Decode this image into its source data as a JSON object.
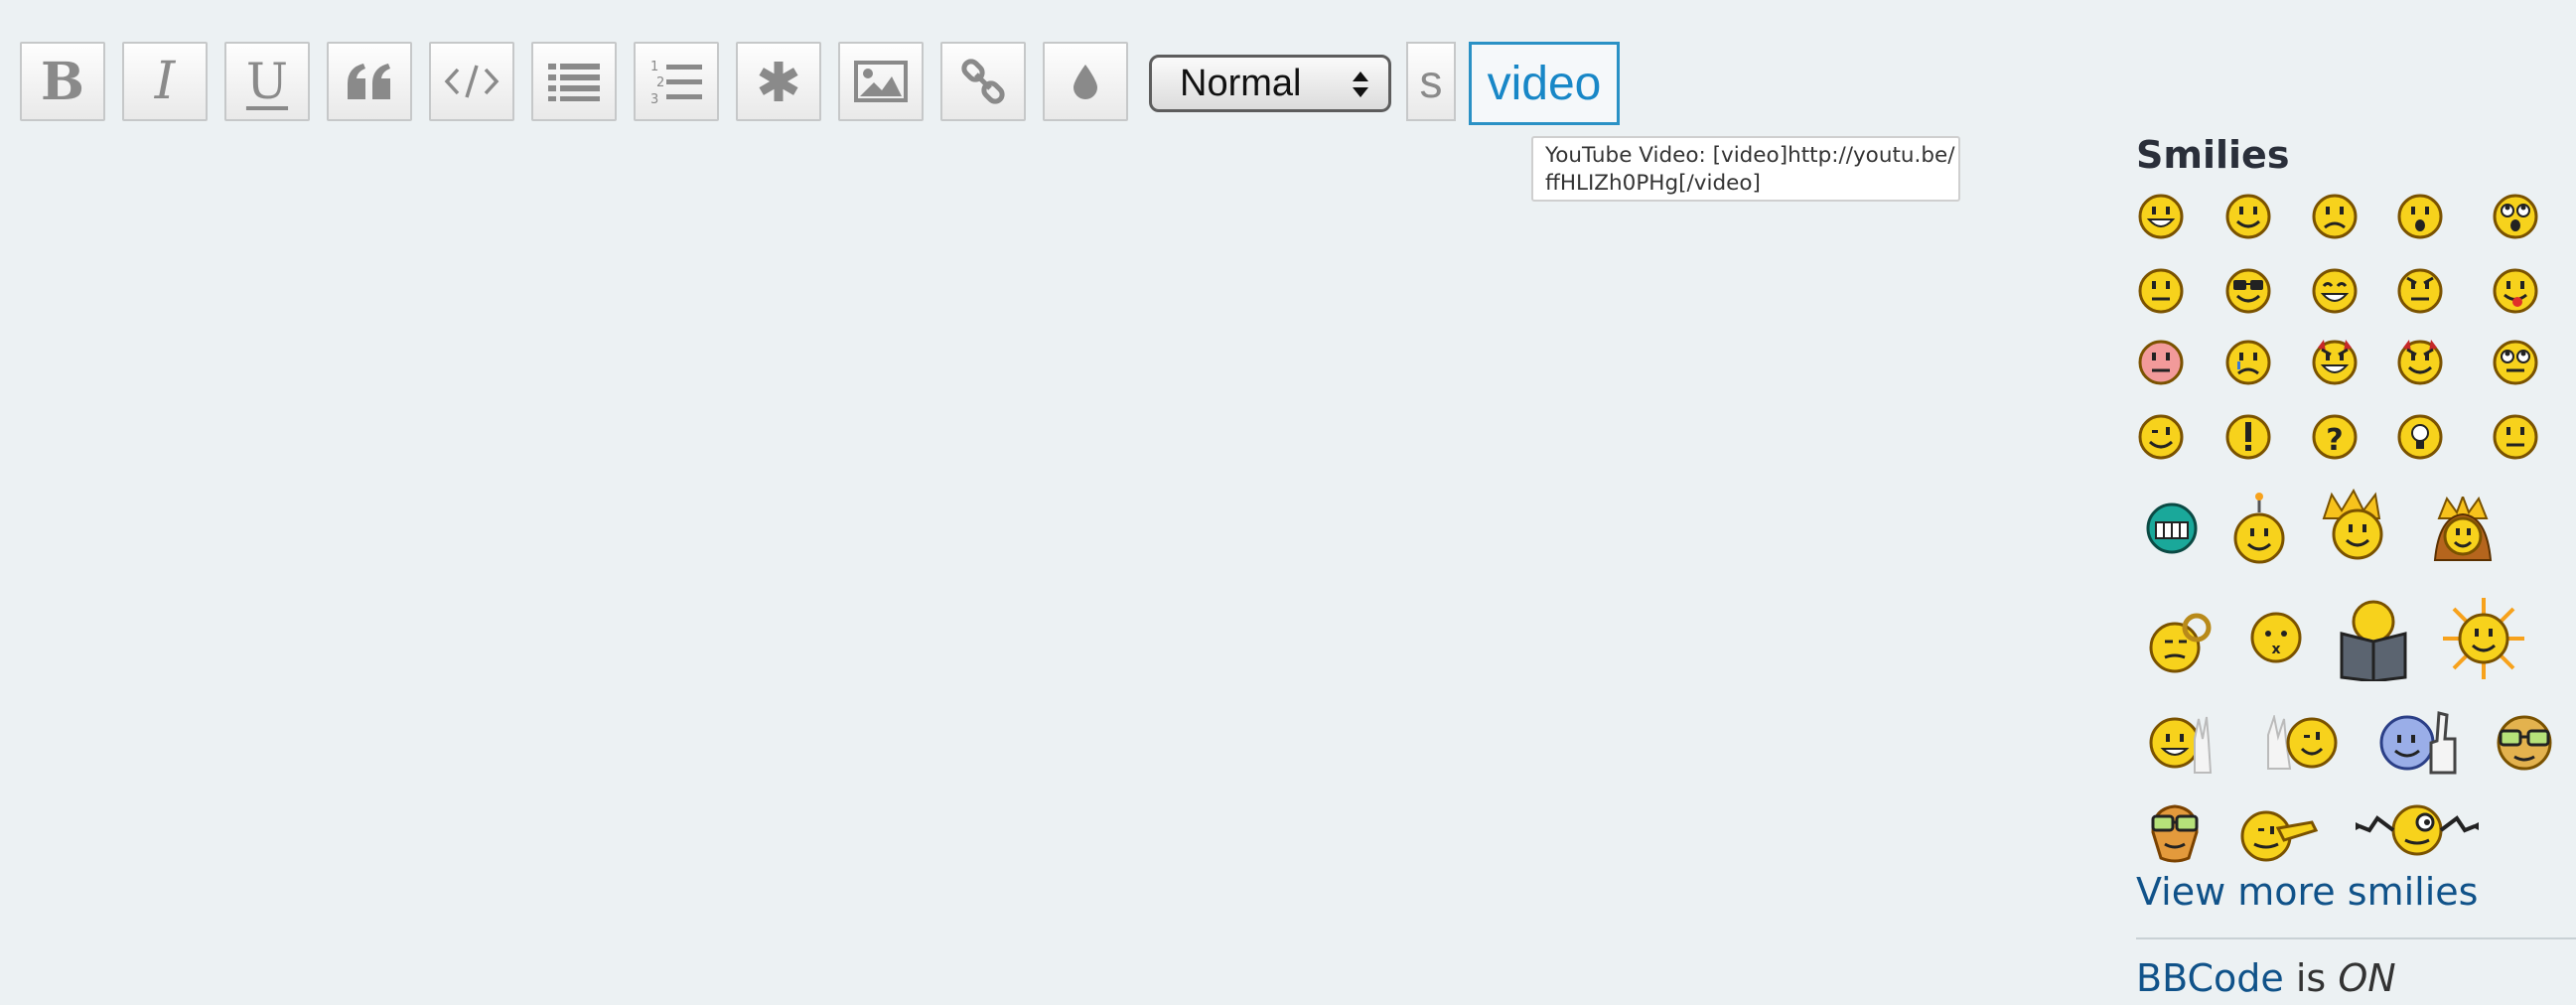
{
  "toolbar": {
    "bold_label": "B",
    "italic_label": "I",
    "underline_label": "U",
    "icons": [
      "quote-icon",
      "code-icon",
      "list-icon",
      "ordered-list-icon",
      "asterisk-icon",
      "image-icon",
      "link-icon",
      "color-drop-icon"
    ],
    "font_size": {
      "selected": "Normal"
    },
    "strike_label": "s",
    "video_label": "video"
  },
  "tooltip": {
    "line1": "YouTube Video: [video]http://youtu.be/",
    "line2": "ffHLIZh0PHg[/video]"
  },
  "smilies": {
    "title": "Smilies",
    "more_link": "View more smilies"
  },
  "bbcode": {
    "link": "BBCode",
    "is": "is",
    "status": "ON"
  },
  "colors": {
    "background": "#ecf1f3",
    "link": "#105289",
    "accent": "#2a91c5",
    "smiley_yellow": "#f7d21c"
  }
}
